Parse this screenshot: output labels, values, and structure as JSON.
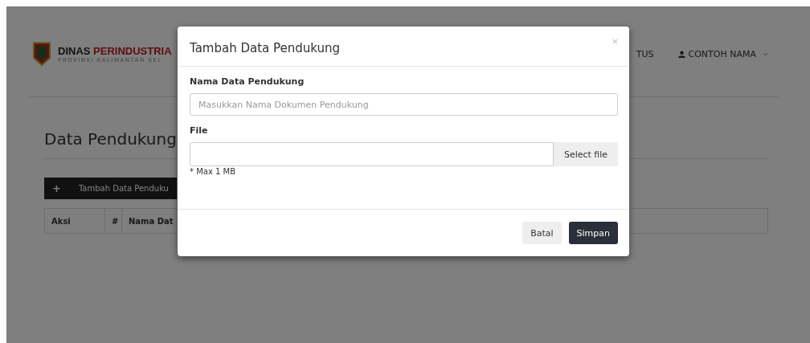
{
  "header": {
    "brand_primary": "DINAS",
    "brand_accent": "PERINDUSTRIA",
    "subtitle": "PROVINSI KALIMANTAN SEL",
    "nav_item": "TUS",
    "user_name": "CONTOH NAMA"
  },
  "page": {
    "title": "Data Pendukung",
    "add_button": "Tambah Data Penduku",
    "add_icon": "+",
    "table": {
      "columns": [
        "Aksi",
        "#",
        "Nama Dat"
      ]
    }
  },
  "modal": {
    "title": "Tambah Data Pendukung",
    "close": "×",
    "fields": [
      {
        "kind": "text",
        "label": "Nama Data Pendukung",
        "placeholder": "Masukkan Nama Dokumen Pendukung"
      },
      {
        "kind": "file",
        "label": "File",
        "button": "Select file",
        "hint": "* Max 1 MB"
      }
    ],
    "buttons": [
      {
        "label": "Batal",
        "kind": "secondary"
      },
      {
        "label": "Simpan",
        "kind": "primary"
      }
    ]
  }
}
